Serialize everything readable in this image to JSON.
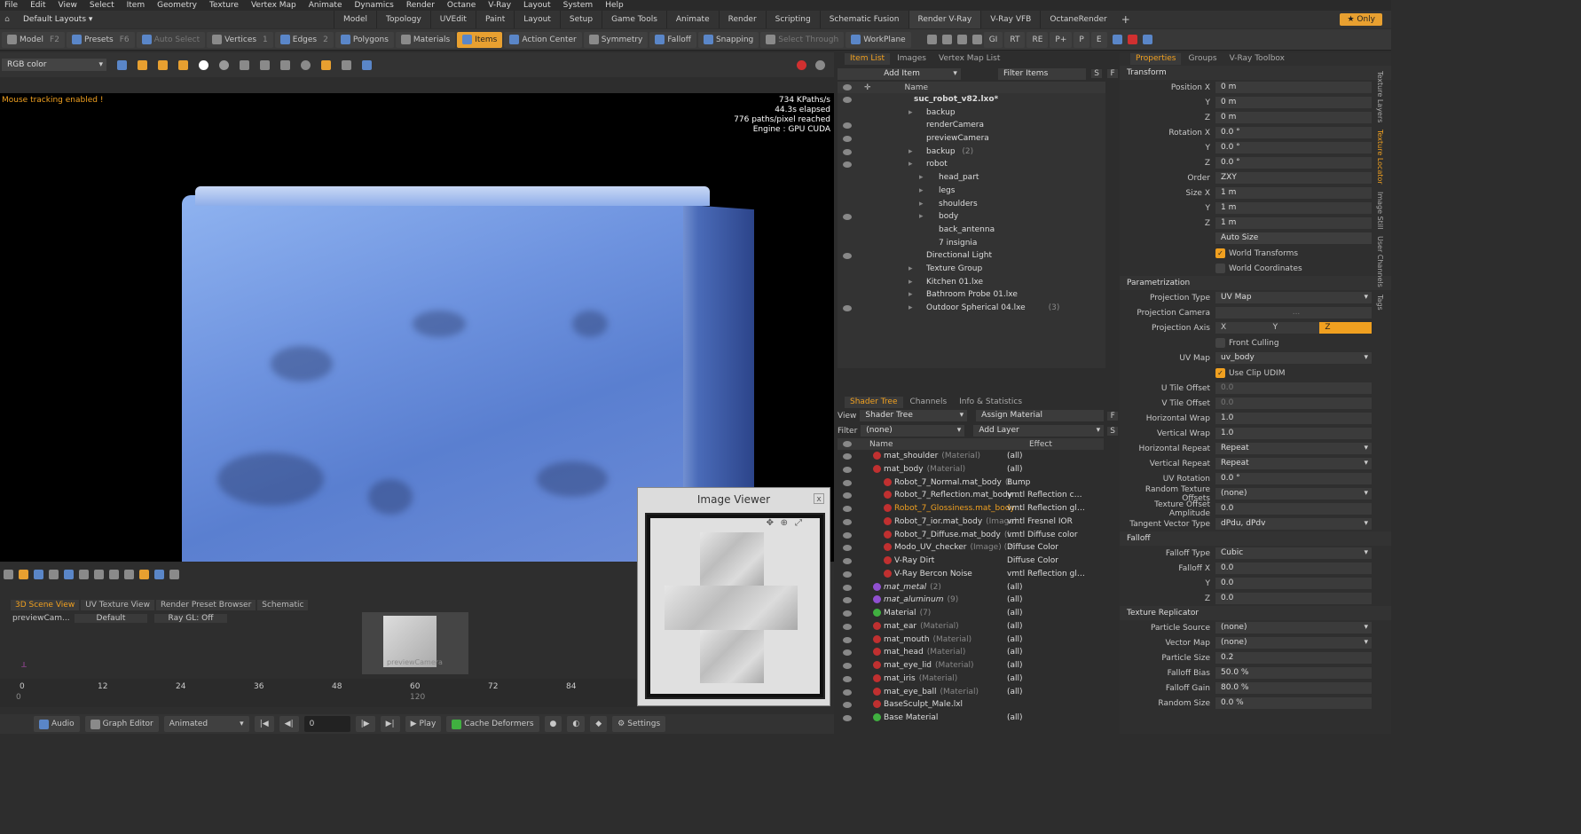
{
  "menubar": {
    "items": [
      "File",
      "Edit",
      "View",
      "Select",
      "Item",
      "Geometry",
      "Texture",
      "Vertex Map",
      "Animate",
      "Dynamics",
      "Render",
      "Octane",
      "V-Ray",
      "Layout",
      "System",
      "Help"
    ]
  },
  "layout": {
    "selector": "Default Layouts",
    "tabs": [
      "Model",
      "Topology",
      "UVEdit",
      "Paint",
      "Layout",
      "Setup",
      "Game Tools",
      "Animate",
      "Render",
      "Scripting",
      "Schematic Fusion",
      "Render V-Ray",
      "V-Ray VFB",
      "OctaneRender"
    ],
    "only_label": "Only"
  },
  "toolbar": {
    "items": [
      {
        "label": "Model",
        "key": "F2"
      },
      {
        "label": "Presets",
        "key": "F6"
      },
      {
        "label": "Auto Select",
        "key": ""
      },
      {
        "label": "Vertices",
        "key": "1"
      },
      {
        "label": "Edges",
        "key": "2"
      },
      {
        "label": "Polygons",
        "key": ""
      },
      {
        "label": "Materials",
        "key": ""
      },
      {
        "label": "Items",
        "key": ""
      },
      {
        "label": "Action Center",
        "key": ""
      },
      {
        "label": "Symmetry",
        "key": ""
      },
      {
        "label": "Falloff",
        "key": ""
      },
      {
        "label": "Snapping",
        "key": ""
      },
      {
        "label": "Select Through",
        "key": ""
      },
      {
        "label": "WorkPlane",
        "key": ""
      }
    ],
    "right_icons": [
      "GI",
      "RT",
      "RE",
      "P+",
      "P",
      "E"
    ]
  },
  "viewport_bar": {
    "channel": "RGB color"
  },
  "viewport": {
    "mouse_msg": "Mouse tracking enabled !",
    "stats": [
      "734 KPaths/s",
      "44.3s elapsed",
      "776 paths/pixel reached",
      "Engine : GPU CUDA"
    ]
  },
  "bottom": {
    "tabs": [
      "3D Scene View",
      "UV Texture View",
      "Render Preset Browser",
      "Schematic"
    ],
    "camera": "previewCam...",
    "preset": "Default",
    "raygl": "Ray GL: Off",
    "thumb_label": "previewCamera"
  },
  "timeline": {
    "ticks": [
      "0",
      "12",
      "24",
      "36",
      "48",
      "60",
      "72",
      "84"
    ],
    "ticks_lower": [
      "0",
      "120"
    ]
  },
  "statusbar": {
    "audio": "Audio",
    "graph": "Graph Editor",
    "mode": "Animated",
    "frame": "0",
    "play": "Play",
    "cache": "Cache Deformers",
    "settings": "Settings"
  },
  "image_viewer": {
    "title": "Image Viewer",
    "close": "x"
  },
  "item_list": {
    "tabs": [
      "Item List",
      "Images",
      "Vertex Map List"
    ],
    "add_item": "Add Item",
    "filter": "Filter Items",
    "col_name": "Name",
    "rows": [
      {
        "name": "suc_robot_v82.lxo*",
        "suffix": "",
        "indent": 0,
        "eye": true,
        "bold": true
      },
      {
        "name": "backup",
        "suffix": "",
        "indent": 1,
        "eye": false
      },
      {
        "name": "renderCamera",
        "suffix": "",
        "indent": 1,
        "eye": true
      },
      {
        "name": "previewCamera",
        "suffix": "",
        "indent": 1,
        "eye": true
      },
      {
        "name": "backup",
        "suffix": "(2)",
        "indent": 1,
        "eye": true
      },
      {
        "name": "robot",
        "suffix": "",
        "indent": 1,
        "eye": true
      },
      {
        "name": "head_part",
        "suffix": "",
        "indent": 2,
        "eye": false
      },
      {
        "name": "legs",
        "suffix": "",
        "indent": 2,
        "eye": false
      },
      {
        "name": "shoulders",
        "suffix": "",
        "indent": 2,
        "eye": false
      },
      {
        "name": "body",
        "suffix": "",
        "indent": 2,
        "eye": true
      },
      {
        "name": "back_antenna",
        "suffix": "",
        "indent": 2,
        "eye": false
      },
      {
        "name": "7 insignia",
        "suffix": "",
        "indent": 2,
        "eye": false
      },
      {
        "name": "Directional Light",
        "suffix": "",
        "indent": 1,
        "eye": true
      },
      {
        "name": "Texture Group",
        "suffix": "",
        "indent": 1,
        "eye": false
      },
      {
        "name": "Kitchen 01.lxe",
        "suffix": "",
        "indent": 1,
        "eye": false
      },
      {
        "name": "Bathroom Probe 01.lxe",
        "suffix": "",
        "indent": 1,
        "eye": false
      },
      {
        "name": "Outdoor Spherical 04.lxe",
        "suffix": "(3)",
        "indent": 1,
        "eye": true
      }
    ]
  },
  "shader_tree": {
    "tabs": [
      "Shader Tree",
      "Channels",
      "Info & Statistics"
    ],
    "view_label": "View",
    "view_value": "Shader Tree",
    "assign": "Assign Material",
    "filter_label": "Filter",
    "filter_value": "(none)",
    "add_layer": "Add Layer",
    "col_name": "Name",
    "col_effect": "Effect",
    "rows": [
      {
        "name": "mat_shoulder",
        "suffix": "(Material)",
        "effect": "(all)",
        "dot": "r",
        "indent": 0
      },
      {
        "name": "mat_body",
        "suffix": "(Material)",
        "effect": "(all)",
        "dot": "r",
        "indent": 0
      },
      {
        "name": "Robot_7_Normal.mat_body",
        "suffix": "(I...",
        "effect": "Bump",
        "dot": "r",
        "indent": 1
      },
      {
        "name": "Robot_7_Reflection.mat_body ...",
        "suffix": "",
        "effect": "vmtl Reflection color",
        "dot": "r",
        "indent": 1
      },
      {
        "name": "Robot_7_Glossiness.mat_body ...",
        "suffix": "",
        "effect": "vmtl Reflection gloss...",
        "dot": "r",
        "indent": 1,
        "selected": true
      },
      {
        "name": "Robot_7_ior.mat_body",
        "suffix": "(Image)",
        "effect": "vmtl Fresnel IOR",
        "dot": "r",
        "indent": 1
      },
      {
        "name": "Robot_7_Diffuse.mat_body",
        "suffix": "(I...",
        "effect": "vmtl Diffuse color",
        "dot": "r",
        "indent": 1
      },
      {
        "name": "Modo_UV_checker",
        "suffix": "(Image) (2)",
        "effect": "Diffuse Color",
        "dot": "r",
        "indent": 1
      },
      {
        "name": "V-Ray Dirt",
        "suffix": "",
        "effect": "Diffuse Color",
        "dot": "r",
        "indent": 1
      },
      {
        "name": "V-Ray Bercon Noise",
        "suffix": "",
        "effect": "vmtl Reflection gloss...",
        "dot": "r",
        "indent": 1
      },
      {
        "name": "mat_metal",
        "suffix": "(2)",
        "effect": "(all)",
        "dot": "p",
        "indent": 0
      },
      {
        "name": "mat_aluminum",
        "suffix": "(9)",
        "effect": "(all)",
        "dot": "p",
        "indent": 0
      },
      {
        "name": "Material",
        "suffix": "(7)",
        "effect": "(all)",
        "dot": "gr",
        "indent": 0
      },
      {
        "name": "mat_ear",
        "suffix": "(Material)",
        "effect": "(all)",
        "dot": "r",
        "indent": 0
      },
      {
        "name": "mat_mouth",
        "suffix": "(Material)",
        "effect": "(all)",
        "dot": "r",
        "indent": 0
      },
      {
        "name": "mat_head",
        "suffix": "(Material)",
        "effect": "(all)",
        "dot": "r",
        "indent": 0
      },
      {
        "name": "mat_eye_lid",
        "suffix": "(Material)",
        "effect": "(all)",
        "dot": "r",
        "indent": 0
      },
      {
        "name": "mat_iris",
        "suffix": "(Material)",
        "effect": "(all)",
        "dot": "r",
        "indent": 0
      },
      {
        "name": "mat_eye_ball",
        "suffix": "(Material)",
        "effect": "(all)",
        "dot": "r",
        "indent": 0
      },
      {
        "name": "BaseSculpt_Male.lxl",
        "suffix": "",
        "effect": "",
        "dot": "r",
        "indent": 0
      },
      {
        "name": "Base Material",
        "suffix": "",
        "effect": "(all)",
        "dot": "gr",
        "indent": 0
      }
    ]
  },
  "properties": {
    "tabs": [
      "Properties",
      "Groups",
      "V-Ray Toolbox"
    ],
    "side_tabs": [
      "Texture Layers",
      "Texture Locator",
      "Image Still",
      "User Channels",
      "Tags"
    ],
    "transform": {
      "title": "Transform",
      "rows": [
        {
          "label": "Position X",
          "value": "0 m"
        },
        {
          "label": "Y",
          "value": "0 m"
        },
        {
          "label": "Z",
          "value": "0 m"
        },
        {
          "label": "Rotation X",
          "value": "0.0 °"
        },
        {
          "label": "Y",
          "value": "0.0 °"
        },
        {
          "label": "Z",
          "value": "0.0 °"
        },
        {
          "label": "Order",
          "value": "ZXY"
        },
        {
          "label": "Size X",
          "value": "1 m"
        },
        {
          "label": "Y",
          "value": "1 m"
        },
        {
          "label": "Z",
          "value": "1 m"
        }
      ],
      "auto_size": "Auto Size",
      "world_transforms": "World Transforms",
      "world_coordinates": "World Coordinates"
    },
    "parametrization": {
      "title": "Parametrization",
      "projection_type_label": "Projection Type",
      "projection_type": "UV Map",
      "projection_camera_label": "Projection Camera",
      "projection_camera": "...",
      "projection_axis_label": "Projection Axis",
      "axes": [
        "X",
        "Y",
        "Z"
      ],
      "front_culling": "Front Culling",
      "uv_map_label": "UV Map",
      "uv_map": "uv_body",
      "use_clip_udim": "Use Clip UDIM",
      "rows": [
        {
          "label": "U Tile Offset",
          "value": "0.0",
          "dim": true
        },
        {
          "label": "V Tile Offset",
          "value": "0.0",
          "dim": true
        },
        {
          "label": "Horizontal Wrap",
          "value": "1.0"
        },
        {
          "label": "Vertical Wrap",
          "value": "1.0"
        },
        {
          "label": "Horizontal Repeat",
          "value": "Repeat",
          "dd": true
        },
        {
          "label": "Vertical Repeat",
          "value": "Repeat",
          "dd": true
        },
        {
          "label": "UV Rotation",
          "value": "0.0 °"
        },
        {
          "label": "Random Texture Offsets",
          "value": "(none)",
          "dd": true
        },
        {
          "label": "Texture Offset Amplitude",
          "value": "0.0"
        },
        {
          "label": "Tangent Vector Type",
          "value": "dPdu, dPdv",
          "dd": true
        }
      ]
    },
    "falloff": {
      "title": "Falloff",
      "rows": [
        {
          "label": "Falloff Type",
          "value": "Cubic",
          "dd": true
        },
        {
          "label": "Falloff X",
          "value": "0.0"
        },
        {
          "label": "Y",
          "value": "0.0"
        },
        {
          "label": "Z",
          "value": "0.0"
        }
      ]
    },
    "replicator": {
      "title": "Texture Replicator",
      "rows": [
        {
          "label": "Particle Source",
          "value": "(none)",
          "dd": true
        },
        {
          "label": "Vector Map",
          "value": "(none)",
          "dd": true
        },
        {
          "label": "Particle Size",
          "value": "0.2"
        },
        {
          "label": "Falloff Bias",
          "value": "50.0 %"
        },
        {
          "label": "Falloff Gain",
          "value": "80.0 %"
        },
        {
          "label": "Random Size",
          "value": "0.0 %"
        }
      ]
    }
  },
  "colors": {
    "accent": "#f0a020",
    "panel": "#2d2d2d",
    "viewport_bg": "#000000"
  }
}
